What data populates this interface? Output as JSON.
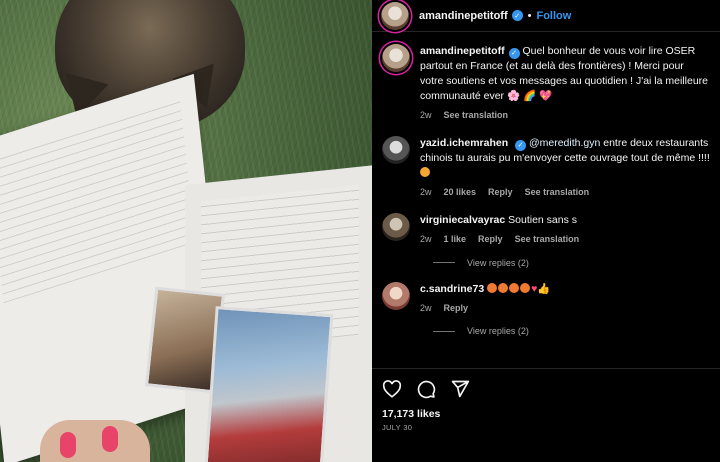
{
  "post": {
    "author": "amandinepetitoff",
    "follow_label": "Follow",
    "caption_author": "amandinepetitoff",
    "caption_text": "Quel bonheur de vous voir lire OSER partout en France (et au delà des frontières) ! Merci pour votre soutiens et vos messages au quotidien ! J'ai la meilleure communauté ever 🌸 🌈 💖",
    "caption_time": "2w",
    "caption_translation": "See translation",
    "likes": "17,173 likes",
    "date": "JULY 30"
  },
  "comments": [
    {
      "user": "yazid.ichemrahen",
      "mention": "@meredith.gyn",
      "text": " entre deux restaurants chinois tu aurais pu m'envoyer cette ouvrage tout de même !!!!",
      "time": "2w",
      "likes": "20 likes",
      "reply": "Reply",
      "translation": "See translation"
    },
    {
      "user": "virginiecalvayrac",
      "text": "Soutien sans s",
      "time": "2w",
      "likes": "1 like",
      "reply": "Reply",
      "translation": "See translation",
      "view_replies": "View replies (2)"
    },
    {
      "user": "c.sandrine73",
      "text": "",
      "time": "2w",
      "reply": "Reply",
      "view_replies": "View replies (2)"
    }
  ],
  "icons": [
    "heart-icon",
    "comment-icon",
    "share-icon",
    "verified-icon"
  ],
  "colors": {
    "accent": "#3797f0",
    "background": "#000000",
    "muted": "#a8a8a8"
  }
}
